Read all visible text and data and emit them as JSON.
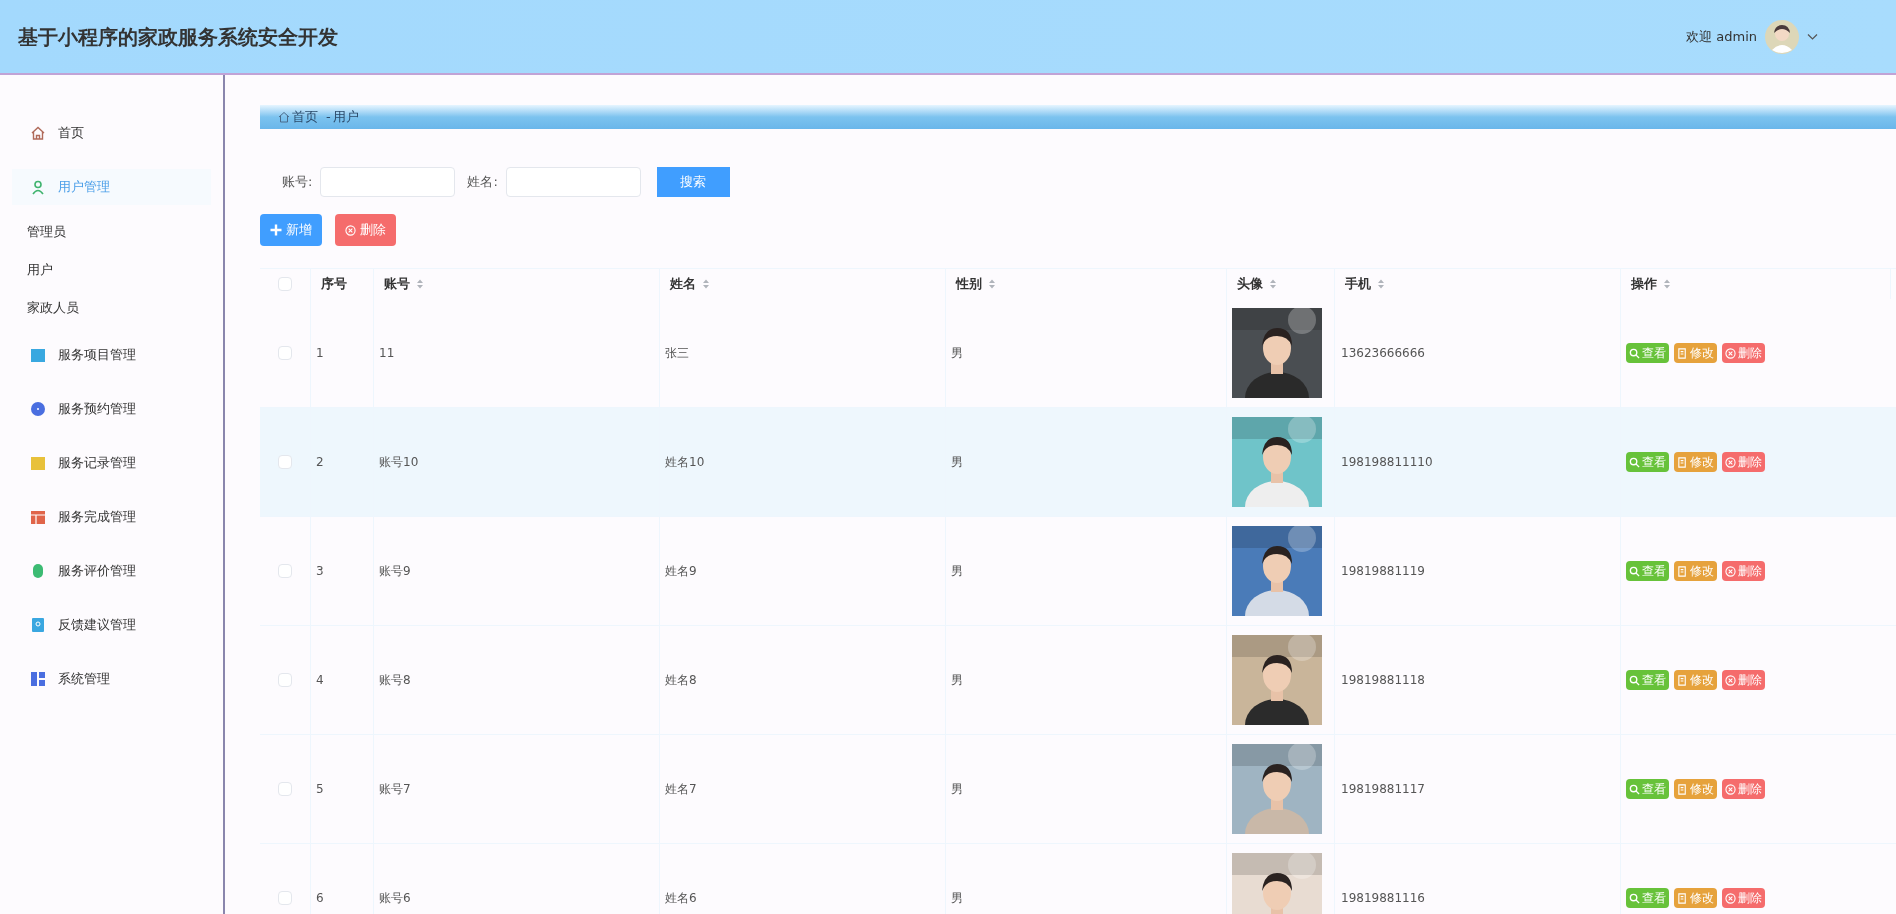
{
  "header": {
    "title": "基于小程序的家政服务系统安全开发",
    "welcome": "欢迎 admin"
  },
  "sidebar": {
    "items": [
      {
        "label": "首页",
        "selected": false
      },
      {
        "label": "用户管理",
        "selected": true,
        "children": [
          {
            "label": "管理员"
          },
          {
            "label": "用户"
          },
          {
            "label": "家政人员"
          }
        ]
      },
      {
        "label": "服务项目管理",
        "selected": false
      },
      {
        "label": "服务预约管理",
        "selected": false
      },
      {
        "label": "服务记录管理",
        "selected": false
      },
      {
        "label": "服务完成管理",
        "selected": false
      },
      {
        "label": "服务评价管理",
        "selected": false
      },
      {
        "label": "反馈建议管理",
        "selected": false
      },
      {
        "label": "系统管理",
        "selected": false
      }
    ]
  },
  "breadcrumb": {
    "items": [
      "首页",
      "用户"
    ],
    "separator": "-"
  },
  "search": {
    "fields": [
      {
        "label": "账号:"
      },
      {
        "label": "姓名:"
      }
    ],
    "button": "搜索"
  },
  "toolbar": [
    {
      "label": "新增",
      "kind": "add"
    },
    {
      "label": "删除",
      "kind": "delete"
    }
  ],
  "table": {
    "header_checkbox": {
      "checked": false
    },
    "columns": [
      {
        "label": "序号",
        "sortable": false
      },
      {
        "label": "账号",
        "sortable": true
      },
      {
        "label": "姓名",
        "sortable": true
      },
      {
        "label": "性别",
        "sortable": true
      },
      {
        "label": "头像",
        "sortable": true
      },
      {
        "label": "手机",
        "sortable": true
      },
      {
        "label": "操作",
        "sortable": true
      }
    ],
    "rows": [
      {
        "checked": false,
        "hovered": false,
        "index": "1",
        "account": "11",
        "name": "张三",
        "gender": "男",
        "phone": "13623666666",
        "actions": [
          {
            "label": "查看",
            "kind": "view"
          },
          {
            "label": "修改",
            "kind": "edit"
          },
          {
            "label": "删除",
            "kind": "delete"
          }
        ]
      },
      {
        "checked": false,
        "hovered": true,
        "index": "2",
        "account": "账号10",
        "name": "姓名10",
        "gender": "男",
        "phone": "198198811110",
        "actions": [
          {
            "label": "查看",
            "kind": "view"
          },
          {
            "label": "修改",
            "kind": "edit"
          },
          {
            "label": "删除",
            "kind": "delete"
          }
        ]
      },
      {
        "checked": false,
        "hovered": false,
        "index": "3",
        "account": "账号9",
        "name": "姓名9",
        "gender": "男",
        "phone": "19819881119",
        "actions": [
          {
            "label": "查看",
            "kind": "view"
          },
          {
            "label": "修改",
            "kind": "edit"
          },
          {
            "label": "删除",
            "kind": "delete"
          }
        ]
      },
      {
        "checked": false,
        "hovered": false,
        "index": "4",
        "account": "账号8",
        "name": "姓名8",
        "gender": "男",
        "phone": "19819881118",
        "actions": [
          {
            "label": "查看",
            "kind": "view"
          },
          {
            "label": "修改",
            "kind": "edit"
          },
          {
            "label": "删除",
            "kind": "delete"
          }
        ]
      },
      {
        "checked": false,
        "hovered": false,
        "index": "5",
        "account": "账号7",
        "name": "姓名7",
        "gender": "男",
        "phone": "19819881117",
        "actions": [
          {
            "label": "查看",
            "kind": "view"
          },
          {
            "label": "修改",
            "kind": "edit"
          },
          {
            "label": "删除",
            "kind": "delete"
          }
        ]
      },
      {
        "checked": false,
        "hovered": false,
        "index": "6",
        "account": "账号6",
        "name": "姓名6",
        "gender": "男",
        "phone": "19819881116",
        "actions": [
          {
            "label": "查看",
            "kind": "view"
          },
          {
            "label": "修改",
            "kind": "edit"
          },
          {
            "label": "删除",
            "kind": "delete"
          }
        ]
      }
    ]
  }
}
